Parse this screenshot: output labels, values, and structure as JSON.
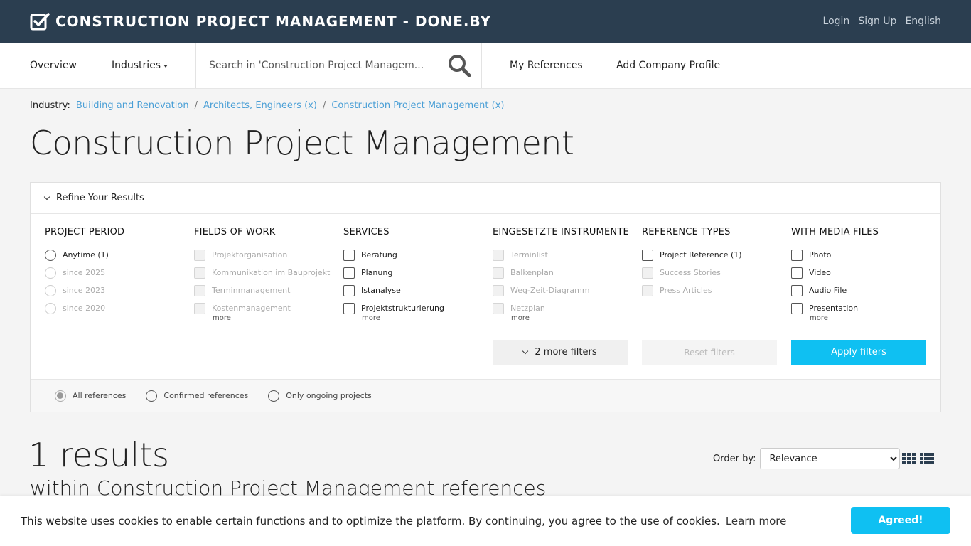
{
  "topbar": {
    "brand_title": "CONSTRUCTION PROJECT MANAGEMENT - DONE.BY",
    "links": [
      "Login",
      "Sign Up",
      "English"
    ]
  },
  "nav": {
    "overview": "Overview",
    "industries": "Industries",
    "search_placeholder": "Search in 'Construction Project Managem...",
    "my_references": "My References",
    "add_company": "Add Company Profile"
  },
  "breadcrumb": {
    "label": "Industry:",
    "items": [
      "Building and Renovation",
      "Architects, Engineers (x)",
      "Construction Project Management (x)"
    ],
    "separator": "/"
  },
  "page_title": "Construction Project Management",
  "filters": {
    "header": "Refine Your Results",
    "project_period": {
      "title": "PROJECT PERIOD",
      "options": [
        "Anytime (1)",
        "since 2025",
        "since 2023",
        "since 2020"
      ]
    },
    "fields_of_work": {
      "title": "FIELDS OF WORK",
      "options": [
        "Projektorganisation",
        "Kommunikation im Bauprojekt",
        "Terminmanagement",
        "Kostenmanagement"
      ],
      "more": "more"
    },
    "services": {
      "title": "SERVICES",
      "options": [
        "Beratung",
        "Planung",
        "Istanalyse",
        "Projektstrukturierung"
      ],
      "more": "more"
    },
    "instruments": {
      "title": "EINGESETZTE INSTRUMENTE",
      "options": [
        "Terminlist",
        "Balkenplan",
        "Weg-Zeit-Diagramm",
        "Netzplan"
      ],
      "more": "more"
    },
    "reference_types": {
      "title": "REFERENCE TYPES",
      "options": [
        "Project Reference (1)",
        "Success Stories",
        "Press Articles"
      ]
    },
    "media_files": {
      "title": "WITH MEDIA FILES",
      "options": [
        "Photo",
        "Video",
        "Audio File",
        "Presentation"
      ],
      "more": "more"
    },
    "more_filters": "2 more filters",
    "reset": "Reset filters",
    "apply": "Apply filters",
    "footer_options": [
      "All references",
      "Confirmed references",
      "Only ongoing projects"
    ]
  },
  "results": {
    "count": "1 results",
    "subtitle": "within Construction Project Management references",
    "order_label": "Order by:",
    "order_value": "Relevance"
  },
  "cookie": {
    "text": "This website uses cookies to enable certain functions and to optimize the platform. By continuing, you agree to the use of cookies.",
    "learn_more": "Learn more",
    "button": "Agreed!"
  },
  "colors": {
    "topbar": "#2b3e50",
    "accent": "#0fc0f2",
    "link": "#4a9fd6"
  }
}
